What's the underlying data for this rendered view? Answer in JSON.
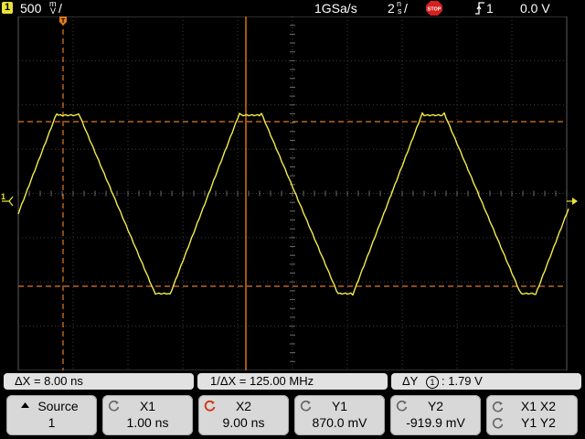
{
  "status_bar": {
    "channel_number": "1",
    "volts_per_div": "500",
    "volts_unit_top": "m",
    "volts_unit_bottom": "V",
    "sample_rate": "1GSa/s",
    "time_per_div": "2",
    "time_unit_top": "n",
    "time_unit_bottom": "s",
    "run_state": "STOP",
    "trigger_source": "1",
    "trigger_level": "0.0 V"
  },
  "readouts": {
    "delta_x": "ΔX =  8.00 ns",
    "inverse_delta_x": "1/ΔX = 125.00 MHz",
    "delta_y_prefix": "ΔY",
    "delta_y_channel": "1",
    "delta_y_value": ": 1.79  V"
  },
  "softkeys": [
    {
      "label": "Source",
      "value": "1",
      "icon": "up-arrow-icon"
    },
    {
      "label": "X1",
      "value": "1.00 ns",
      "icon": "knob-icon"
    },
    {
      "label": "X2",
      "value": "9.00 ns",
      "icon": "knob-icon"
    },
    {
      "label": "Y1",
      "value": "870.0 mV",
      "icon": "knob-icon"
    },
    {
      "label": "Y2",
      "value": "-919.9 mV",
      "icon": "knob-icon"
    },
    {
      "label": "X1  X2",
      "value": "Y1  Y2",
      "icon": "knob-icon"
    }
  ],
  "colors": {
    "trace": "#f2ee4a",
    "cursor": "#e07a20",
    "grid": "#5a5a5a",
    "active_knob": "#d03010",
    "badge": "#e8e33a"
  }
}
